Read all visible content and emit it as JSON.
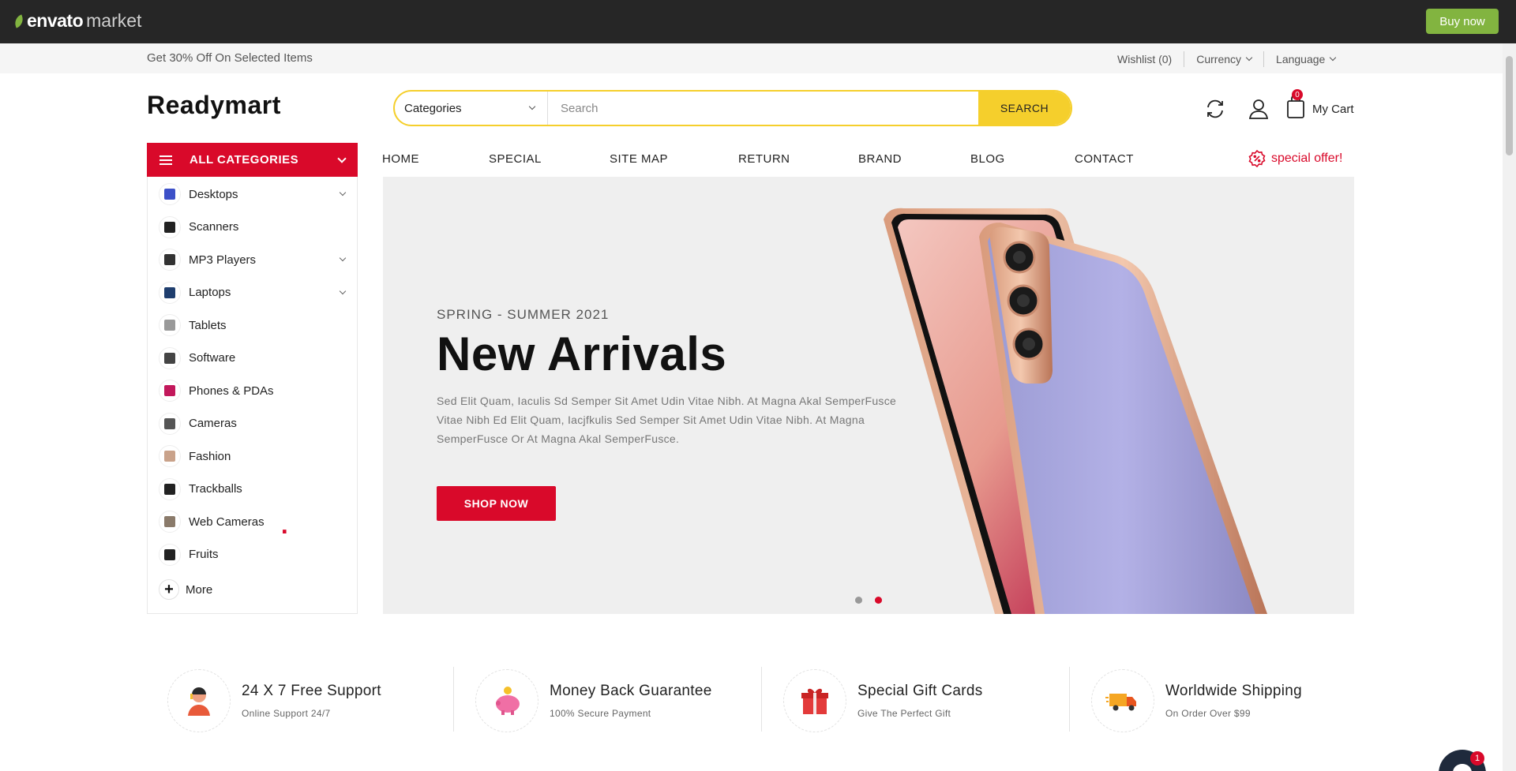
{
  "envato": {
    "logo_brand": "envato",
    "logo_market": "market",
    "buy_now": "Buy now",
    "accent": "#82b440"
  },
  "topbar": {
    "promo": "Get 30% Off On Selected Items",
    "wishlist": "Wishlist (0)",
    "currency": "Currency",
    "language": "Language"
  },
  "header": {
    "logo": "Readymart",
    "logo_dot": ".",
    "category_select": "Categories",
    "search_placeholder": "Search",
    "search_button": "SEARCH",
    "cart_label": "My Cart",
    "cart_count": "0",
    "accent": "#d9092a",
    "search_accent": "#f5cf2c"
  },
  "sidebar": {
    "title": "ALL CATEGORIES",
    "items": [
      {
        "label": "Desktops",
        "has_children": true
      },
      {
        "label": "Scanners",
        "has_children": false
      },
      {
        "label": "MP3 Players",
        "has_children": true
      },
      {
        "label": "Laptops",
        "has_children": true
      },
      {
        "label": "Tablets",
        "has_children": false
      },
      {
        "label": "Software",
        "has_children": false
      },
      {
        "label": "Phones & PDAs",
        "has_children": false
      },
      {
        "label": "Cameras",
        "has_children": false
      },
      {
        "label": "Fashion",
        "has_children": false
      },
      {
        "label": "Trackballs",
        "has_children": false
      },
      {
        "label": "Web Cameras",
        "has_children": false
      },
      {
        "label": "Fruits",
        "has_children": false
      }
    ],
    "more": "More"
  },
  "nav": {
    "items": [
      "HOME",
      "SPECIAL",
      "SITE MAP",
      "RETURN",
      "BRAND",
      "BLOG",
      "CONTACT"
    ],
    "special_offer": "special offer!"
  },
  "hero": {
    "subtitle": "SPRING - SUMMER 2021",
    "title": "New Arrivals",
    "description": "Sed Elit Quam, Iaculis Sd Semper Sit Amet Udin Vitae Nibh. At Magna Akal SemperFusce Vitae Nibh Ed Elit Quam, Iacjfkulis Sed Semper Sit Amet Udin Vitae Nibh. At Magna SemperFusce Or At Magna Akal SemperFusce.",
    "button": "SHOP NOW",
    "slides": 2,
    "active_slide": 2
  },
  "features": [
    {
      "title": "24 X 7 Free Support",
      "subtitle": "Online Support 24/7",
      "icon": "support-agent-icon"
    },
    {
      "title": "Money Back Guarantee",
      "subtitle": "100% Secure Payment",
      "icon": "piggy-bank-icon"
    },
    {
      "title": "Special Gift Cards",
      "subtitle": "Give The Perfect Gift",
      "icon": "gift-icon"
    },
    {
      "title": "Worldwide Shipping",
      "subtitle": "On Order Over $99",
      "icon": "delivery-truck-icon"
    }
  ],
  "chat": {
    "unread": "1"
  }
}
